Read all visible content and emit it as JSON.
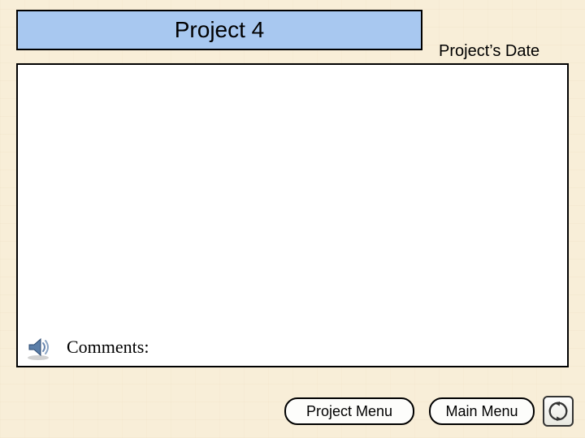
{
  "header": {
    "title": "Project 4",
    "date_label": "Project’s Date"
  },
  "main": {
    "comments_label": "Comments:"
  },
  "footer": {
    "project_menu_label": "Project Menu",
    "main_menu_label": "Main Menu"
  },
  "icons": {
    "speaker": "speaker-icon",
    "return": "return-icon"
  }
}
